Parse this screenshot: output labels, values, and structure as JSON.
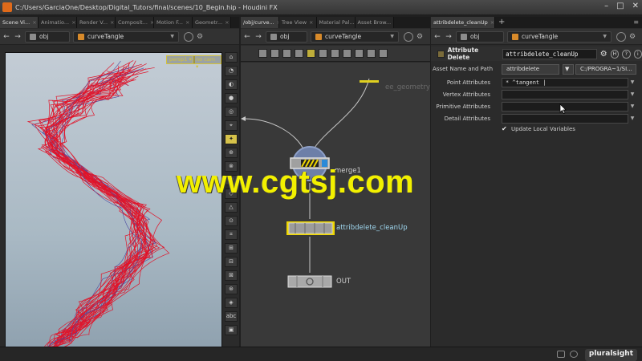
{
  "window": {
    "title": "C:/Users/GarciaOne/Desktop/Digital_Tutors/final/scenes/10_Begin.hip - Houdini FX",
    "controls": [
      "–",
      "□",
      "✕"
    ]
  },
  "left_pane": {
    "tabs": [
      "Scene Vi...",
      "Animatio...",
      "Render V...",
      "Composit...",
      "Motion F...",
      "Geometr..."
    ],
    "path": {
      "back": "←",
      "forward": "→",
      "root": "obj",
      "node": "curveTangle"
    },
    "viewport": {
      "camera_button": "persp1 ▾",
      "display_button": "no cam ▾"
    }
  },
  "middle_pane": {
    "tabs": [
      "/obj/curve...",
      "Tree View",
      "Material Pal...",
      "Asset Brow..."
    ],
    "path": {
      "back": "←",
      "forward": "→",
      "root": "obj",
      "node": "curveTangle"
    },
    "nodes": [
      {
        "name": "merge1",
        "type": "merge"
      },
      {
        "name": "attribdelete_cleanUp",
        "type": "attribdelete"
      },
      {
        "name": "OUT",
        "type": "null"
      }
    ],
    "faded_label": "ee_geometry"
  },
  "right_pane": {
    "tabs": [
      "attribdelete_cleanUp"
    ],
    "path": {
      "back": "←",
      "forward": "→",
      "root": "obj",
      "node": "curveTangle"
    },
    "header": {
      "type_label": "Attribute Delete",
      "node_name": "attribdelete_cleanUp"
    },
    "asset": {
      "label": "Asset Name and Path",
      "name": "attribdelete",
      "path": "C:/PROGRA~1/SI..."
    },
    "parameters": [
      {
        "label": "Point Attributes",
        "value": "* ^tangent |"
      },
      {
        "label": "Vertex Attributes",
        "value": ""
      },
      {
        "label": "Primitive Attributes",
        "value": ""
      },
      {
        "label": "Detail Attributes",
        "value": ""
      }
    ],
    "checkbox": {
      "label": "Update Local Variables",
      "checked": true,
      "mark": "✔"
    }
  },
  "watermark": "www.cgtsj.com",
  "brand": "pluralsight",
  "colors": {
    "accent": "#e06a1a",
    "curve": "#e0142a",
    "wire": "#c8c8c8",
    "node_selected": "#f0d800",
    "watermark": "#f2f000"
  },
  "icons": [
    "houdini-icon",
    "back-arrow-icon",
    "forward-arrow-icon",
    "pin-icon",
    "gear-icon",
    "help-icon",
    "info-icon",
    "lock-icon",
    "chevron-down-icon",
    "cursor-icon"
  ]
}
